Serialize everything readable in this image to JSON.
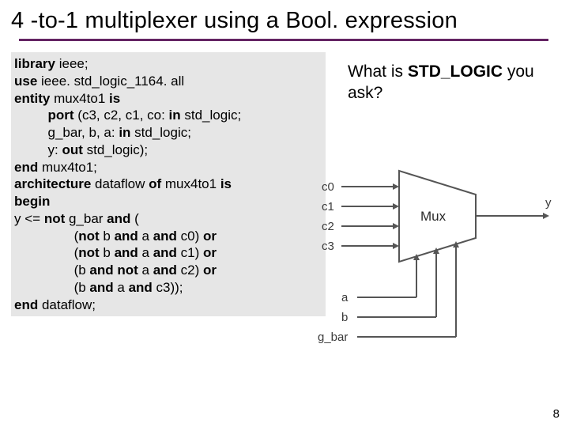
{
  "title": "4 -to-1 multiplexer using a Bool. expression",
  "code": {
    "l1_a": "library",
    "l1_b": " ieee;",
    "l2_a": "use",
    "l2_b": " ieee. std_logic_1164. all",
    "l3_a": "entity",
    "l3_b": " mux4to1 ",
    "l3_c": "is",
    "l4_a": "         port ",
    "l4_b": "(c3, c2, c1, co: ",
    "l4_c": "in",
    "l4_d": " std_logic;",
    "l5_a": "         g_bar, b, a: ",
    "l5_b": "in",
    "l5_c": " std_logic;",
    "l6_a": "         y: ",
    "l6_b": "out",
    "l6_c": " std_logic);",
    "l7_a": "end ",
    "l7_b": "mux4to1;",
    "l8_a": "architecture ",
    "l8_b": "dataflow ",
    "l8_c": "of ",
    "l8_d": "mux4to1 ",
    "l8_e": "is",
    "l9_a": "begin",
    "l10_a": "y <= ",
    "l10_b": "not ",
    "l10_c": "g_bar ",
    "l10_d": "and ",
    "l10_e": "(",
    "l11_a": "                (",
    "l11_b": "not ",
    "l11_c": "b ",
    "l11_d": "and ",
    "l11_e": "a ",
    "l11_f": "and ",
    "l11_g": "c0) ",
    "l11_h": "or",
    "l12_a": "                (",
    "l12_b": "not ",
    "l12_c": "b ",
    "l12_d": "and ",
    "l12_e": "a ",
    "l12_f": "and ",
    "l12_g": "c1) ",
    "l12_h": "or",
    "l13_a": "                (b ",
    "l13_b": "and not ",
    "l13_c": "a ",
    "l13_d": "and ",
    "l13_e": "c2) ",
    "l13_f": "or",
    "l14_a": "                (b ",
    "l14_b": "and ",
    "l14_c": "a ",
    "l14_d": "and ",
    "l14_e": "c3));",
    "l15_a": "end ",
    "l15_b": "dataflow;"
  },
  "question": {
    "pre": "What is ",
    "bold": "STD_LOGIC",
    "post": " you ask?"
  },
  "diagram": {
    "c0": "c0",
    "c1": "c1",
    "c2": "c2",
    "c3": "c3",
    "a": "a",
    "b": "b",
    "gbar": "g_bar",
    "mux": "Mux",
    "y": "y"
  },
  "pagenum": "8"
}
